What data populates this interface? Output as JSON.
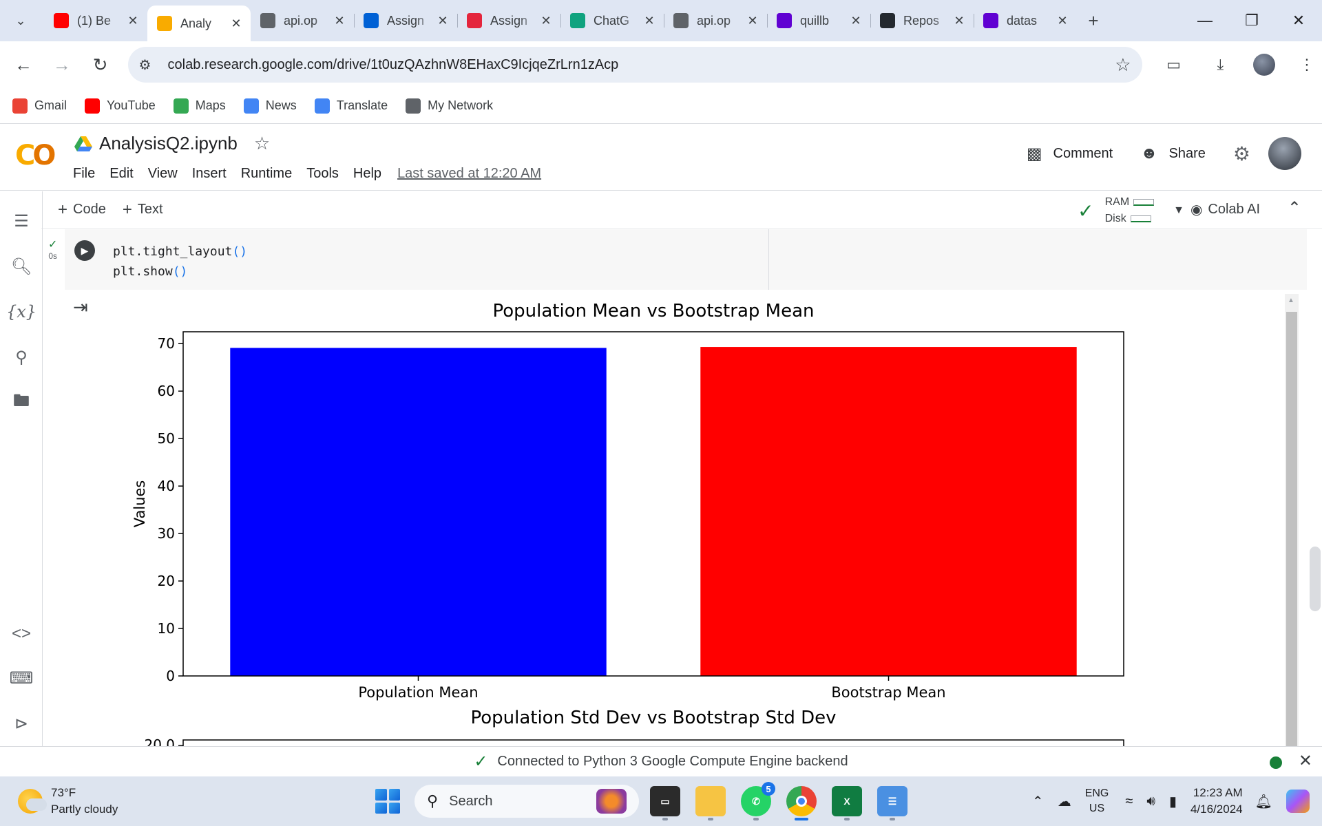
{
  "browser": {
    "tabs": [
      {
        "title": "(1) Be",
        "fav": "youtube-icon",
        "color": "#ff0000",
        "active": false
      },
      {
        "title": "Analy",
        "fav": "colab-icon",
        "color": "#f9ab00",
        "active": true
      },
      {
        "title": "api.op",
        "fav": "globe-icon",
        "color": "#5f6368",
        "active": false
      },
      {
        "title": "Assign",
        "fav": "box-icon",
        "color": "#0061d5",
        "active": false
      },
      {
        "title": "Assign",
        "fav": "canvas-icon",
        "color": "#e4253c",
        "active": false
      },
      {
        "title": "ChatG",
        "fav": "chatgpt-icon",
        "color": "#10a37f",
        "active": false
      },
      {
        "title": "api.op",
        "fav": "globe-icon",
        "color": "#5f6368",
        "active": false
      },
      {
        "title": "quillb",
        "fav": "yahoo-icon",
        "color": "#6001d2",
        "active": false
      },
      {
        "title": "Repos",
        "fav": "github-icon",
        "color": "#24292f",
        "active": false
      },
      {
        "title": "datas",
        "fav": "yahoo-icon",
        "color": "#6001d2",
        "active": false
      }
    ],
    "url": "colab.research.google.com/drive/1t0uzQAzhnW8EHaxC9IcjqeZrLrn1zAcp",
    "bookmarks": [
      {
        "label": "Gmail",
        "icon": "gmail-icon",
        "color": "#ea4335"
      },
      {
        "label": "YouTube",
        "icon": "youtube-icon",
        "color": "#ff0000"
      },
      {
        "label": "Maps",
        "icon": "maps-icon",
        "color": "#34a853"
      },
      {
        "label": "News",
        "icon": "news-icon",
        "color": "#4285f4"
      },
      {
        "label": "Translate",
        "icon": "translate-icon",
        "color": "#4285f4"
      },
      {
        "label": "My Network",
        "icon": "globe-icon",
        "color": "#5f6368"
      }
    ]
  },
  "colab": {
    "notebook_title": "AnalysisQ2.ipynb",
    "menu": [
      "File",
      "Edit",
      "View",
      "Insert",
      "Runtime",
      "Tools",
      "Help"
    ],
    "last_saved": "Last saved at 12:20 AM",
    "comment_label": "Comment",
    "share_label": "Share",
    "add_code": "Code",
    "add_text": "Text",
    "ram_label": "RAM",
    "disk_label": "Disk",
    "colab_ai_label": "Colab AI",
    "cell": {
      "exec_time": "0s",
      "lines": [
        "plt.tight_layout",
        "plt.show"
      ]
    },
    "status_message": "Connected to Python 3 Google Compute Engine backend"
  },
  "chart_data": [
    {
      "type": "bar",
      "title": "Population Mean vs Bootstrap Mean",
      "categories": [
        "Population Mean",
        "Bootstrap Mean"
      ],
      "values": [
        69.1,
        69.3
      ],
      "colors": [
        "#0000ff",
        "#ff0000"
      ],
      "xlabel": "",
      "ylabel": "Values",
      "ylim": [
        0,
        72.5
      ],
      "yticks": [
        0,
        10,
        20,
        30,
        40,
        50,
        60,
        70
      ],
      "grid": false
    },
    {
      "type": "bar",
      "title": "Population Std Dev vs Bootstrap Std Dev",
      "yticks_visible": [
        "20.0"
      ],
      "partially_visible": true
    }
  ],
  "taskbar": {
    "weather_temp": "73°F",
    "weather_desc": "Partly cloudy",
    "search_label": "Search",
    "whatsapp_badge": "5",
    "lang_line1": "ENG",
    "lang_line2": "US",
    "time": "12:23 AM",
    "date": "4/16/2024"
  }
}
